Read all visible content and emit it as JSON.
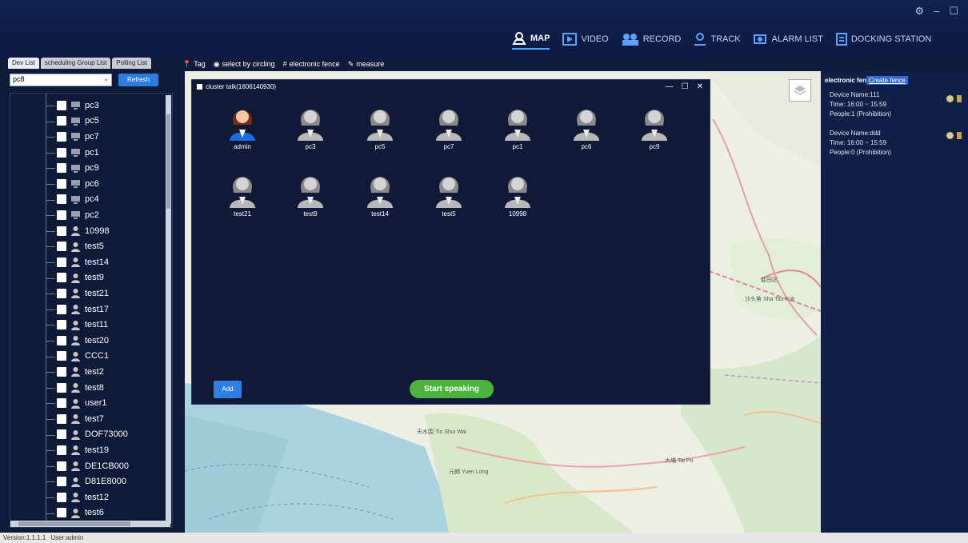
{
  "window": {
    "controls": [
      "⚙",
      "–",
      "☐"
    ]
  },
  "nav": {
    "tabs": [
      {
        "label": "MAP",
        "active": true,
        "icon": "map-pin-icon"
      },
      {
        "label": "VIDEO",
        "active": false,
        "icon": "video-play-icon"
      },
      {
        "label": "RECORD",
        "active": false,
        "icon": "record-people-icon"
      },
      {
        "label": "TRACK",
        "active": false,
        "icon": "track-pin-icon"
      },
      {
        "label": "ALARM LIST",
        "active": false,
        "icon": "alarm-list-icon"
      },
      {
        "label": "DOCKING STATION",
        "active": false,
        "icon": "docking-station-icon"
      }
    ]
  },
  "left_panel": {
    "tabs": [
      "Dev List",
      "scheduling Group List",
      "Polling List"
    ],
    "search_value": "pc8",
    "refresh_label": "Refresh",
    "devices": [
      "pc3",
      "pc5",
      "pc7",
      "pc1",
      "pc9",
      "pc6",
      "pc4",
      "pc2"
    ],
    "users": [
      "10998",
      "test5",
      "test14",
      "test9",
      "test21",
      "test17",
      "test11",
      "test20",
      "CCC1",
      "test2",
      "test8",
      "user1",
      "test7",
      "DOF73000",
      "test19",
      "DE1CB000",
      "D81E8000",
      "test12",
      "test6"
    ]
  },
  "toolbar": {
    "tag": "Tag",
    "circling": "select by circling",
    "fence": "electronic fence",
    "measure": "measure"
  },
  "dialog": {
    "title": "cluster talk(1606140930)",
    "members": [
      "admin",
      "pc3",
      "pc5",
      "pc7",
      "pc1",
      "pc6",
      "pc9",
      "test21",
      "test9",
      "test14",
      "test5",
      "10998"
    ],
    "add_label": "Add",
    "speak_label": "Start speaking"
  },
  "fence_panel": {
    "title": "electronic fen",
    "create_label": "Create fence",
    "fences": [
      {
        "name": "Device Name:111",
        "time": "Time: 16:00 ~ 15:59",
        "people": "People:1 (Prohibition)"
      },
      {
        "name": "Device Name:ddd",
        "time": "Time: 16:00 ~ 15:59",
        "people": "People:0 (Prohibition)"
      }
    ]
  },
  "status": {
    "version": "Version:1.1.1.1",
    "user": "User:admin"
  },
  "map_labels": [
    "天水围 Tin Shui Wai",
    "元朗 Yuen Long",
    "盐田区",
    "沙头角 Sha Tau Kok",
    "大埔 Tai Po"
  ],
  "colors": {
    "accent": "#2d7de0",
    "speak": "#4cb43c",
    "header": "#0f2250"
  }
}
